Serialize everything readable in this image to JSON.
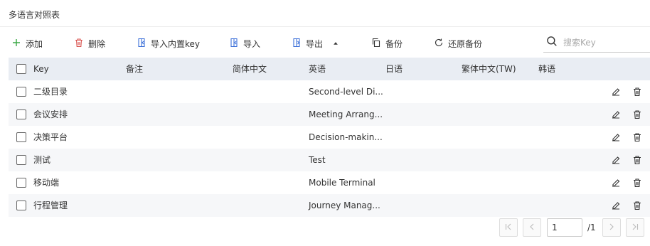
{
  "page": {
    "title": "多语言对照表"
  },
  "toolbar": {
    "add_label": "添加",
    "delete_label": "删除",
    "import_builtin_label": "导入内置key",
    "import_label": "导入",
    "export_label": "导出",
    "backup_label": "备份",
    "restore_label": "还原备份",
    "search_placeholder": "搜索Key"
  },
  "table": {
    "columns": [
      "Key",
      "备注",
      "简体中文",
      "英语",
      "日语",
      "繁体中文(TW)",
      "韩语"
    ],
    "rows": [
      {
        "key": "二级目录",
        "note": "",
        "zh": "",
        "en": "Second-level Di...",
        "ja": "",
        "tw": "",
        "ko": ""
      },
      {
        "key": "会议安排",
        "note": "",
        "zh": "",
        "en": "Meeting Arrang...",
        "ja": "",
        "tw": "",
        "ko": ""
      },
      {
        "key": "决策平台",
        "note": "",
        "zh": "",
        "en": "Decision-makin...",
        "ja": "",
        "tw": "",
        "ko": ""
      },
      {
        "key": "测试",
        "note": "",
        "zh": "",
        "en": "Test",
        "ja": "",
        "tw": "",
        "ko": ""
      },
      {
        "key": "移动端",
        "note": "",
        "zh": "",
        "en": "Mobile Terminal",
        "ja": "",
        "tw": "",
        "ko": ""
      },
      {
        "key": "行程管理",
        "note": "",
        "zh": "",
        "en": "Journey Manag...",
        "ja": "",
        "tw": "",
        "ko": ""
      }
    ]
  },
  "pagination": {
    "current_page": "1",
    "total_label": "/1"
  },
  "colors": {
    "add_icon": "#3aa845",
    "delete_icon": "#d9534f",
    "import_icon": "#3b6fd8",
    "header_bg": "#e9edf3",
    "row_alt_bg": "#f6f7f9"
  }
}
